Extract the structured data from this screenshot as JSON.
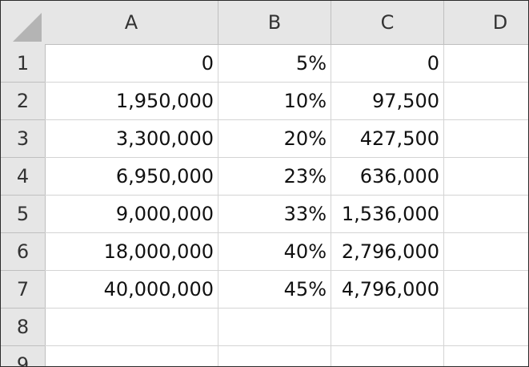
{
  "columns": [
    "A",
    "B",
    "C",
    "D"
  ],
  "rows": [
    {
      "num": "1",
      "cells": [
        "0",
        "5%",
        "0",
        ""
      ]
    },
    {
      "num": "2",
      "cells": [
        "1,950,000",
        "10%",
        "97,500",
        ""
      ]
    },
    {
      "num": "3",
      "cells": [
        "3,300,000",
        "20%",
        "427,500",
        ""
      ]
    },
    {
      "num": "4",
      "cells": [
        "6,950,000",
        "23%",
        "636,000",
        ""
      ]
    },
    {
      "num": "5",
      "cells": [
        "9,000,000",
        "33%",
        "1,536,000",
        ""
      ]
    },
    {
      "num": "6",
      "cells": [
        "18,000,000",
        "40%",
        "2,796,000",
        ""
      ]
    },
    {
      "num": "7",
      "cells": [
        "40,000,000",
        "45%",
        "4,796,000",
        ""
      ]
    },
    {
      "num": "8",
      "cells": [
        "",
        "",
        "",
        ""
      ]
    },
    {
      "num": "9",
      "cells": [
        "",
        "",
        "",
        ""
      ]
    }
  ]
}
